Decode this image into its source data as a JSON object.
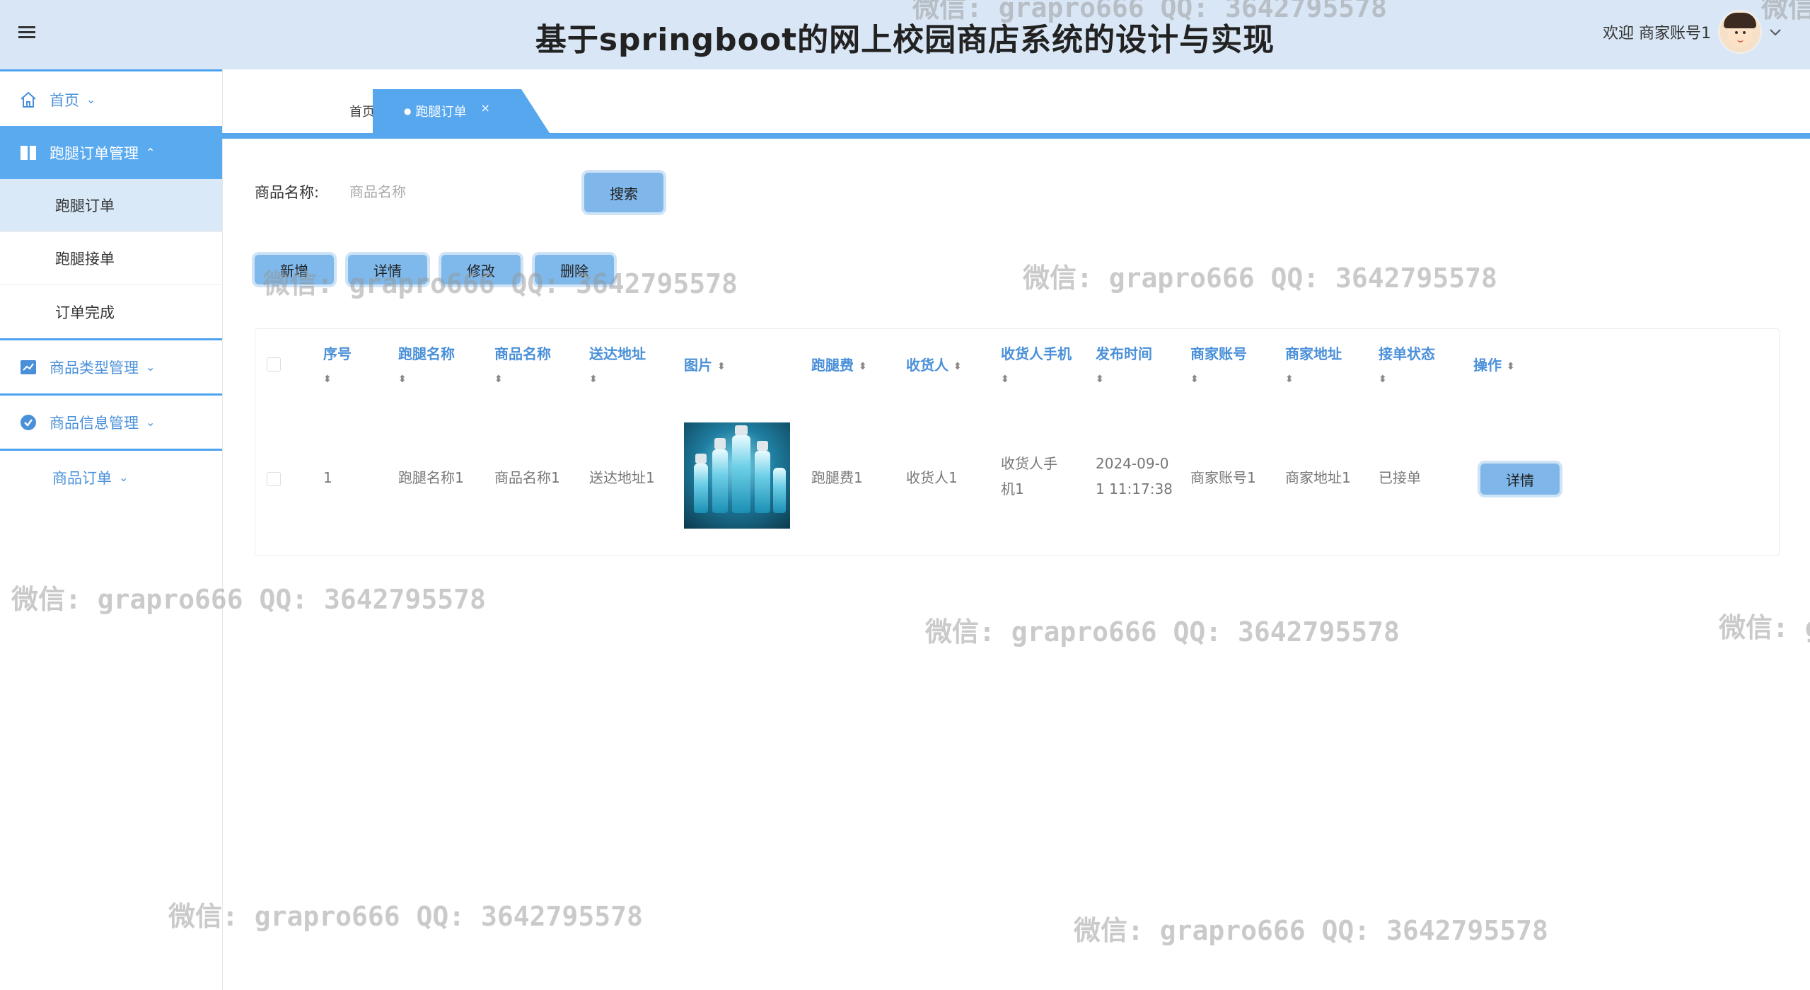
{
  "app": {
    "title": "基于springboot的网上校园商店系统的设计与实现",
    "welcome": "欢迎 商家账号1"
  },
  "sidebar": {
    "items": [
      {
        "label": "首页",
        "icon": "home-icon"
      },
      {
        "label": "跑腿订单管理",
        "icon": "columns-icon"
      },
      {
        "label": "商品类型管理",
        "icon": "chart-icon"
      },
      {
        "label": "商品信息管理",
        "icon": "check-circle-icon"
      },
      {
        "label": "商品订单"
      }
    ],
    "subitems": [
      "跑腿订单",
      "跑腿接单",
      "订单完成"
    ]
  },
  "tabs": {
    "home": "首页",
    "active": "跑腿订单",
    "close_symbol": "×"
  },
  "search": {
    "label": "商品名称:",
    "placeholder": "商品名称",
    "button": "搜索"
  },
  "toolbar": {
    "add": "新增",
    "detail": "详情",
    "edit": "修改",
    "delete": "删除"
  },
  "table": {
    "headers": [
      "序号",
      "跑腿名称",
      "商品名称",
      "送达地址",
      "图片",
      "跑腿费",
      "收货人",
      "收货人手机",
      "发布时间",
      "商家账号",
      "商家地址",
      "接单状态",
      "操作"
    ],
    "rows": [
      {
        "index": "1",
        "errand_name": "跑腿名称1",
        "product_name": "商品名称1",
        "address": "送达地址1",
        "fee": "跑腿费1",
        "receiver": "收货人1",
        "receiver_phone": [
          "收货人手",
          "机1"
        ],
        "publish_time": [
          "2024-09-0",
          "1 11:17:38"
        ],
        "merchant_account": "商家账号1",
        "merchant_address": "商家地址1",
        "status": "已接单",
        "action": "详情"
      }
    ]
  },
  "watermark": "微信: grapro666 QQ: 3642795578",
  "colors": {
    "header_bg": "#d9e6f5",
    "accent": "#57a7ef",
    "button": "#80b7ea"
  }
}
